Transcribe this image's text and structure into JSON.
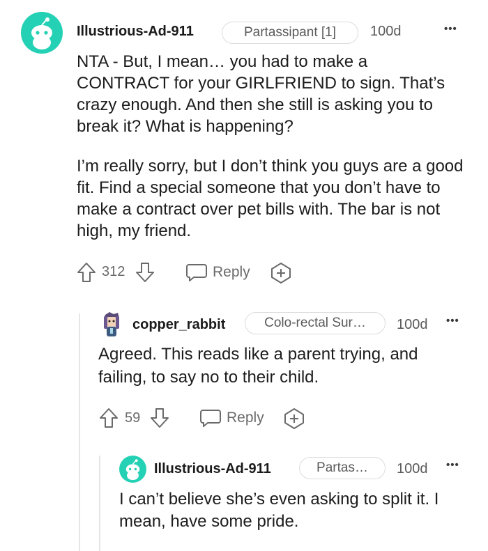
{
  "comments": [
    {
      "username": "Illustrious-Ad-911",
      "flair": "Partassipant [1]",
      "age": "100d",
      "more": "•••",
      "paragraphs": [
        "NTA - But, I mean… you had to make a CONTRACT for your GIRLFRIEND to sign. That’s crazy enough. And then she still is asking you to break it? What is happening?",
        "I’m really sorry, but I don’t think you guys are a good fit. Find a special someone that you don’t have to make a contract over pet bills with. The bar is not high, my friend."
      ],
      "votes": "312",
      "reply_label": "Reply"
    },
    {
      "username": "copper_rabbit",
      "flair": "Colo-rectal Sur…",
      "age": "100d",
      "more": "•••",
      "paragraphs": [
        "Agreed. This reads like a parent trying, and failing, to say no to their child."
      ],
      "votes": "59",
      "reply_label": "Reply"
    },
    {
      "username": "Illustrious-Ad-911",
      "flair": "Partas…",
      "age": "100d",
      "more": "•••",
      "paragraphs": [
        "I can’t believe she’s even asking to split it. I mean, have some pride."
      ]
    }
  ],
  "colors": {
    "avatar_teal": "#24d1b5",
    "text": "#1c1c1c",
    "muted": "#5a5a5a"
  },
  "icons": [
    "reddit-snoo-avatar-icon",
    "upvote-arrow-icon",
    "downvote-arrow-icon",
    "comment-bubble-icon",
    "award-plus-icon",
    "more-options-icon"
  ]
}
